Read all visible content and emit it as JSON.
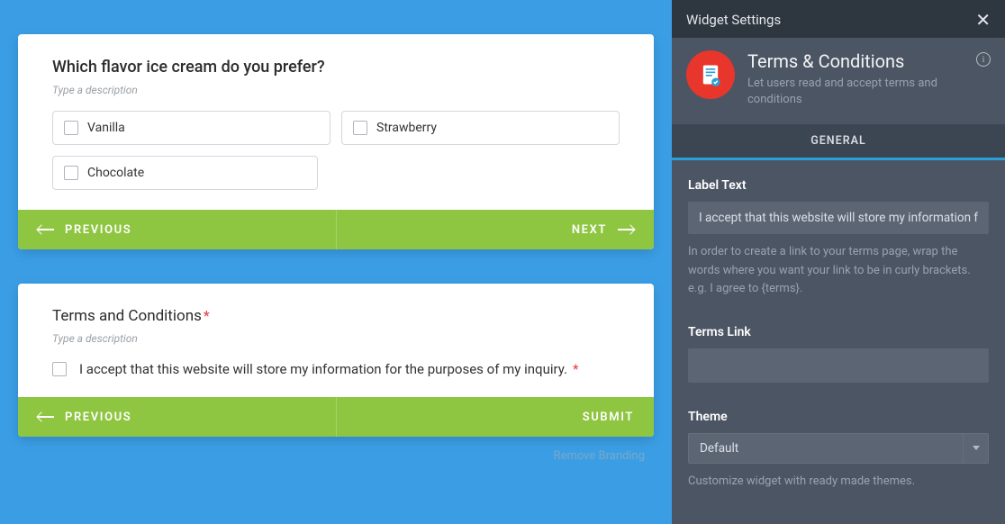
{
  "form": {
    "question1": {
      "title": "Which flavor ice cream do you prefer?",
      "description_placeholder": "Type a description",
      "options": [
        "Vanilla",
        "Strawberry",
        "Chocolate"
      ]
    },
    "nav1": {
      "prev": "PREVIOUS",
      "next": "NEXT"
    },
    "question2": {
      "title": "Terms and Conditions",
      "required_mark": "*",
      "description_placeholder": "Type a description",
      "accept_text": "I accept that this website will store my information for the purposes of my inquiry.",
      "required_suffix": "*"
    },
    "nav2": {
      "prev": "PREVIOUS",
      "submit": "SUBMIT"
    },
    "remove_branding": "Remove Branding"
  },
  "sidebar": {
    "header": "Widget Settings",
    "widget": {
      "title": "Terms & Conditions",
      "subtitle": "Let users read and accept terms and conditions"
    },
    "tab_general": "GENERAL",
    "fields": {
      "label_text": {
        "label": "Label Text",
        "value": "I accept that this website will store my information for",
        "help": "In order to create a link to your terms page, wrap the words where you want your link to be in curly brackets. e.g. I agree to {terms}."
      },
      "terms_link": {
        "label": "Terms Link",
        "value": ""
      },
      "theme": {
        "label": "Theme",
        "value": "Default",
        "help": "Customize widget with ready made themes."
      }
    }
  }
}
